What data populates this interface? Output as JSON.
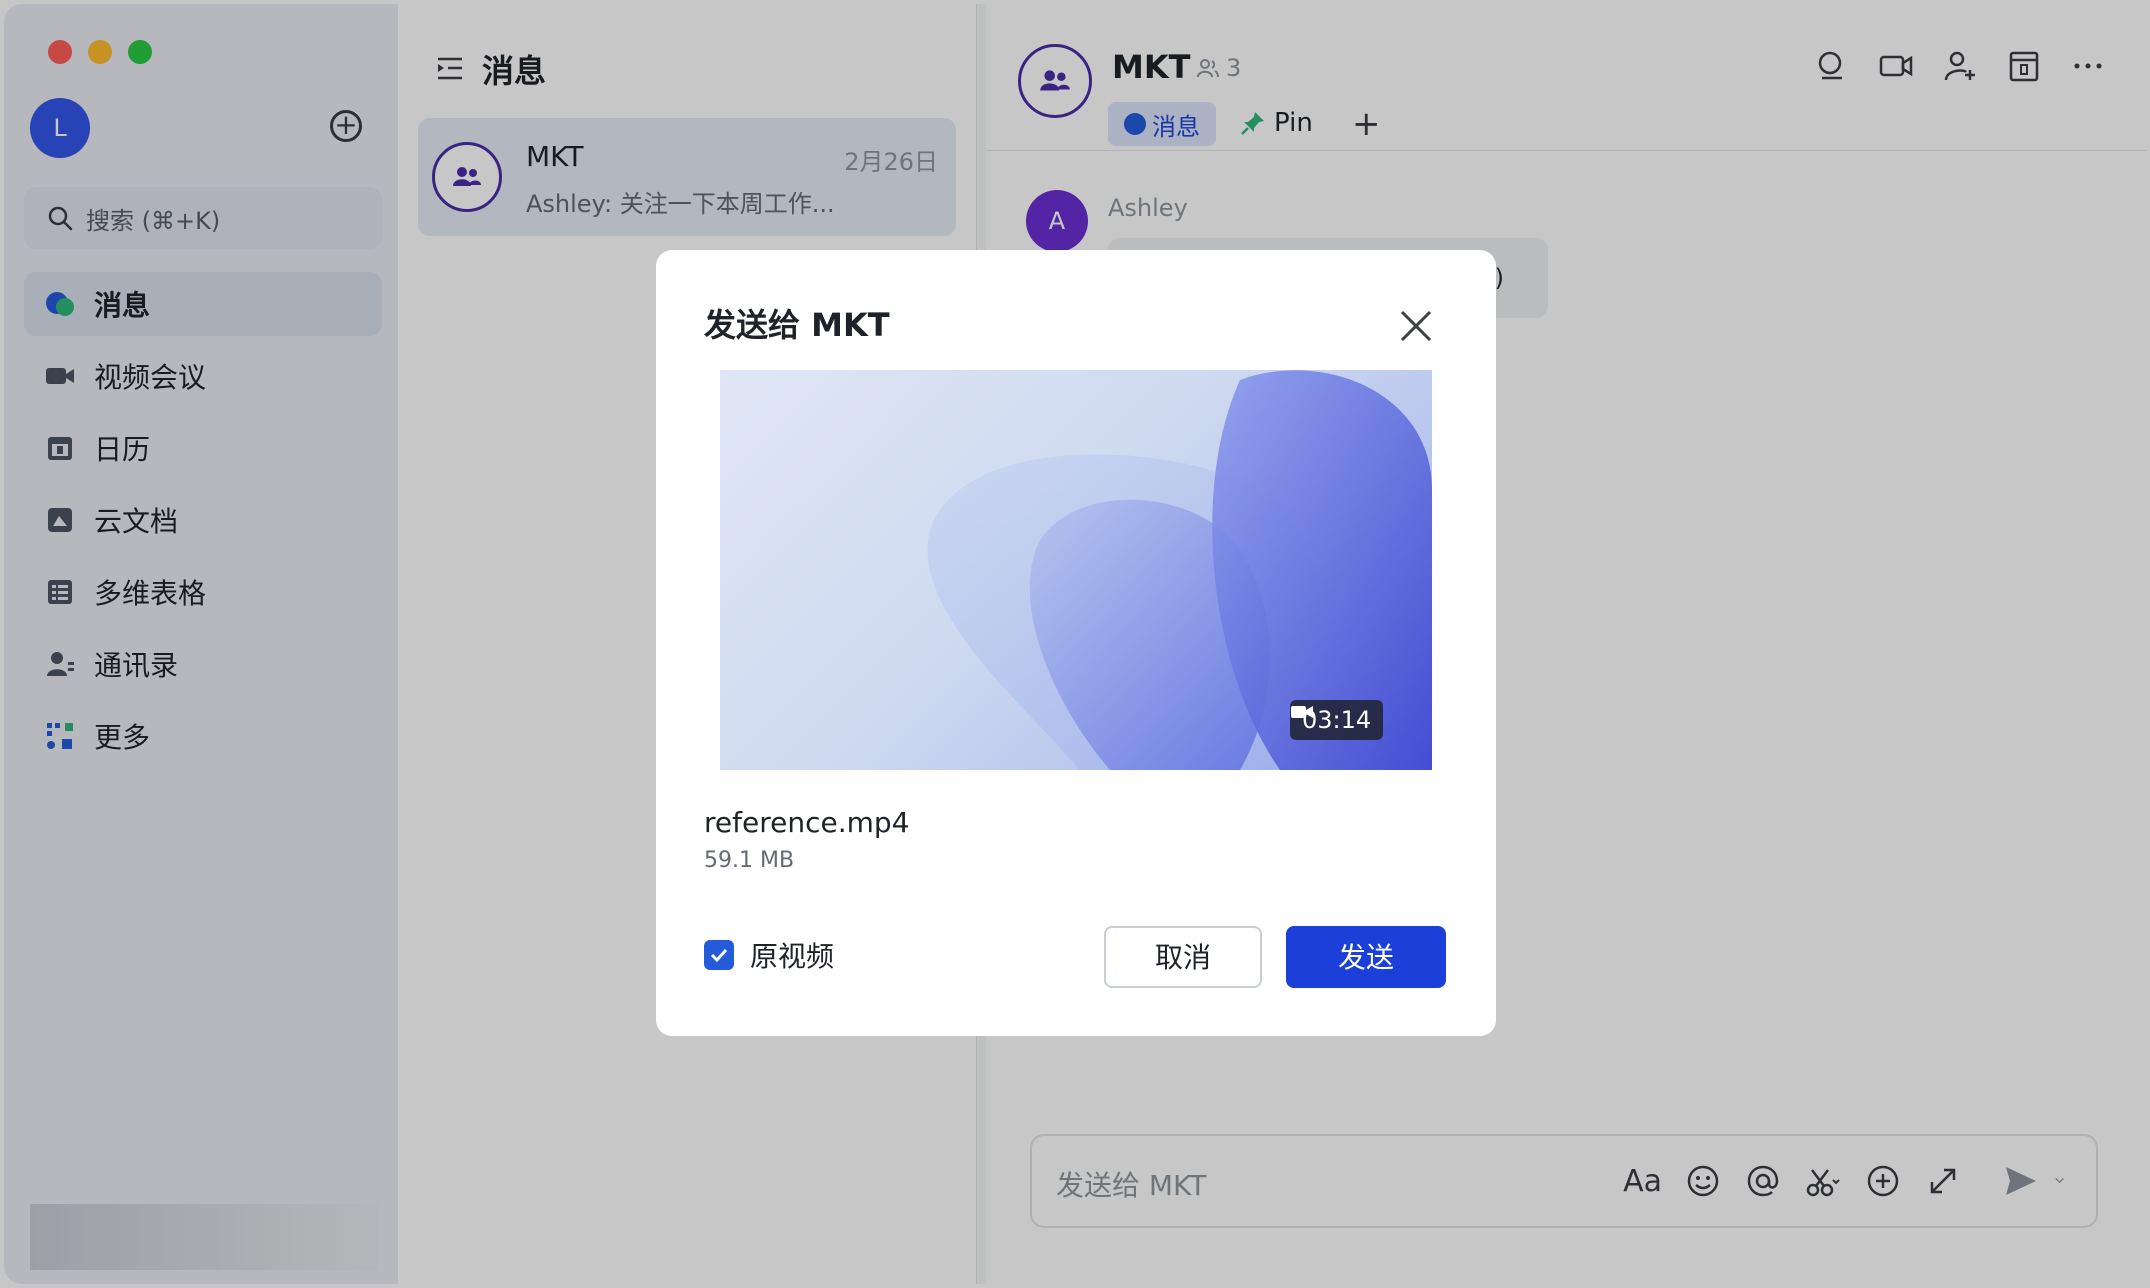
{
  "sidebar": {
    "avatar_initial": "L",
    "search_placeholder": "搜索 (⌘+K)",
    "items": [
      {
        "label": "消息"
      },
      {
        "label": "视频会议"
      },
      {
        "label": "日历"
      },
      {
        "label": "云文档"
      },
      {
        "label": "多维表格"
      },
      {
        "label": "通讯录"
      },
      {
        "label": "更多"
      }
    ]
  },
  "list": {
    "header": "消息",
    "chats": [
      {
        "name": "MKT",
        "date": "2月26日",
        "preview": "Ashley: 关注一下本周工作..."
      }
    ]
  },
  "chat": {
    "title": "MKT",
    "member_count": "3",
    "tabs": {
      "messages": "消息",
      "pin": "Pin"
    },
    "message": {
      "sender_initial": "A",
      "sender": "Ashley",
      "text_fragment": "留)"
    },
    "composer_placeholder": "发送给 MKT",
    "format_label": "Aa"
  },
  "dialog": {
    "title": "发送给 MKT",
    "duration": "03:14",
    "file_name": "reference.mp4",
    "file_size": "59.1 MB",
    "checkbox_label": "原视频",
    "checkbox_checked": true,
    "cancel_label": "取消",
    "send_label": "发送"
  },
  "colors": {
    "accent": "#1d3fd9",
    "group_avatar_border": "#4b2fa8",
    "traffic_red": "#fe5f57",
    "traffic_yellow": "#febc2e",
    "traffic_green": "#28c840"
  }
}
